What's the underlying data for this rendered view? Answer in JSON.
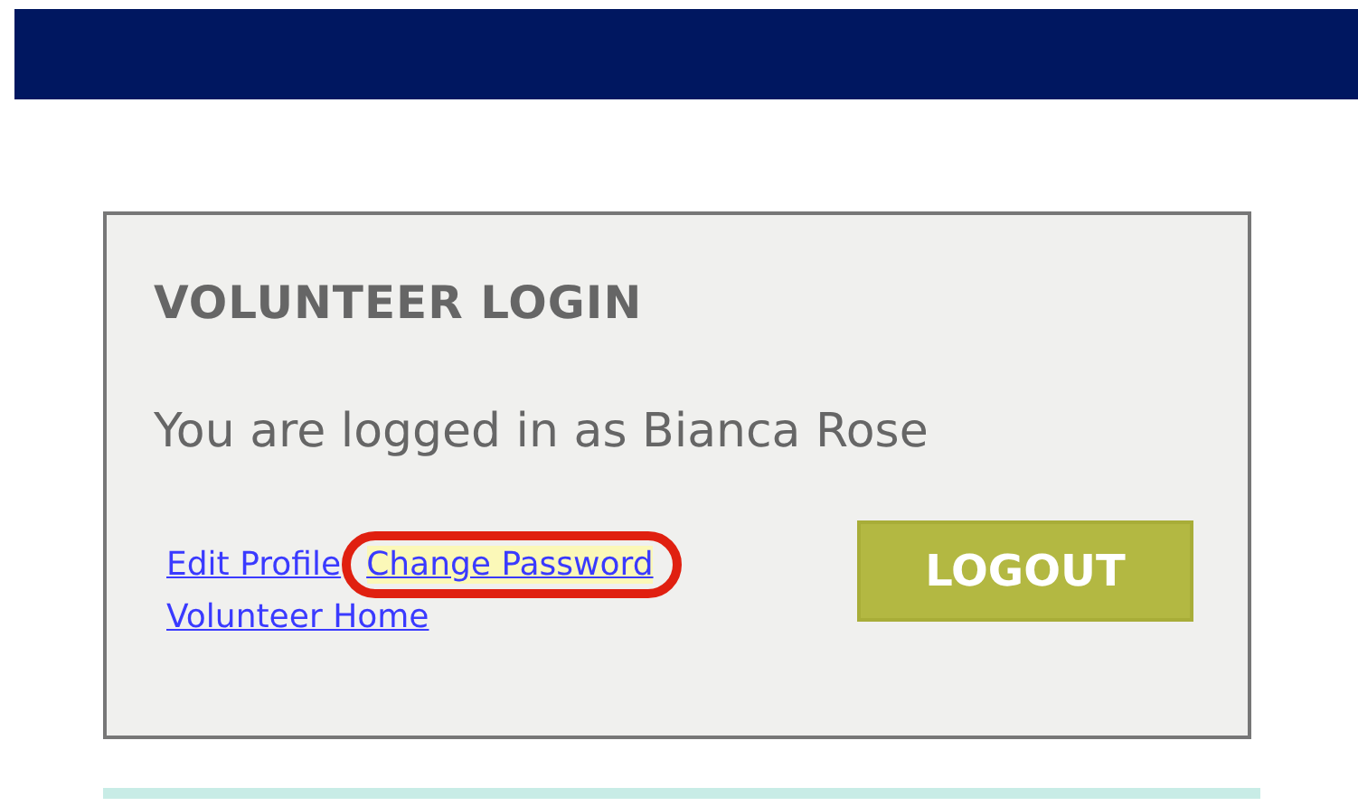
{
  "login_panel": {
    "title": "VOLUNTEER LOGIN",
    "status": "You are logged in as Bianca Rose",
    "links": [
      {
        "label": "Edit Profile",
        "highlighted": false
      },
      {
        "label": "Change Password",
        "highlighted": true
      },
      {
        "label": "Volunteer Home",
        "highlighted": false
      }
    ],
    "logout_button": "LOGOUT"
  }
}
